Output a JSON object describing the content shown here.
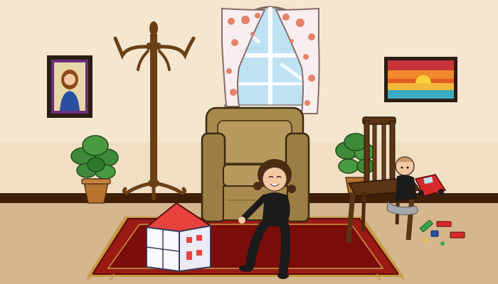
{
  "scene": {
    "colors": {
      "wall": "#f4e6cf",
      "wall_lower": "#ead7b7",
      "baseboard": "#3f1f08",
      "floor": "#d4b68f",
      "rug_outer": "#9c1a14",
      "rug_inner": "#7a0d0a",
      "rug_fringe": "#c79a44",
      "armchair": "#a88a4f",
      "armchair_shadow": "#8c7038",
      "wood": "#6b3f16",
      "chair_wood": "#5a3414",
      "plant_leaf": "#3f8a3a",
      "pot": "#b8742f",
      "curtain": "#f8eef0",
      "curtain_flower": "#e5826a",
      "sky": "#bfe2f2",
      "dollhouse_roof": "#e8423f",
      "girl_clothes": "#1b1b1b",
      "skin": "#f3c9a4",
      "hair": "#4a2d12",
      "toy_car": "#d62a2a"
    },
    "icons": [
      "window-icon",
      "curtain-icon",
      "portrait-frame-icon",
      "sunset-painting-icon",
      "coat-rack-icon",
      "potted-plant-icon",
      "armchair-icon",
      "wooden-chair-icon",
      "rug-icon",
      "dollhouse-icon",
      "girl-figure-icon",
      "baby-figure-icon",
      "toy-car-icon",
      "toy-blocks-icon"
    ]
  }
}
